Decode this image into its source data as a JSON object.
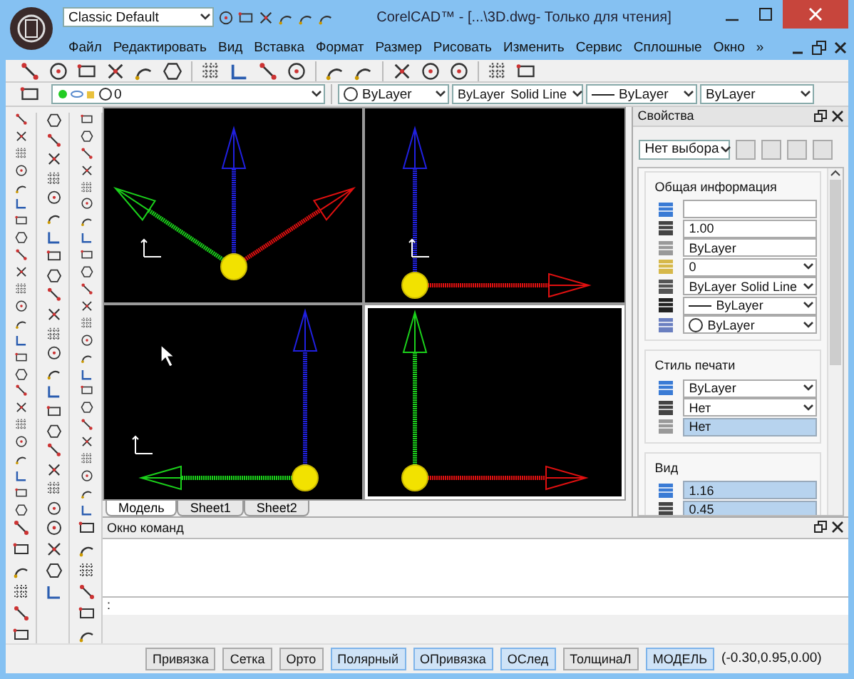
{
  "window": {
    "title": "CorelCAD™ - [...\\3D.dwg- Только для чтения]"
  },
  "workspace": {
    "value": "Classic Default"
  },
  "menu": {
    "items": [
      "Файл",
      "Редактировать",
      "Вид",
      "Вставка",
      "Формат",
      "Размер",
      "Рисовать",
      "Изменить",
      "Сервис",
      "Сплошные",
      "Окно"
    ],
    "more": "»"
  },
  "layer_bar": {
    "layer": "0",
    "color_label": "ByLayer",
    "linetype": "ByLayer",
    "linetype_name": "Solid Line",
    "lineweight": "ByLayer",
    "plot_style": "ByLayer"
  },
  "viewports": [
    {
      "active": false
    },
    {
      "active": false
    },
    {
      "active": false
    },
    {
      "active": true
    }
  ],
  "sheet_tabs": [
    {
      "label": "Модель",
      "selected": true
    },
    {
      "label": "Sheet1",
      "selected": false
    },
    {
      "label": "Sheet2",
      "selected": false
    }
  ],
  "properties": {
    "title": "Свойства",
    "selection": "Нет выбора",
    "sections": [
      {
        "title": "Общая информация",
        "rows": [
          {
            "kind": "input"
          },
          {
            "kind": "input",
            "value": "1.00"
          },
          {
            "kind": "input",
            "value": "ByLayer"
          },
          {
            "kind": "select",
            "value": "0"
          },
          {
            "kind": "select",
            "value": "ByLayer",
            "extra": "Solid Line"
          },
          {
            "kind": "line-select",
            "value": "ByLayer"
          },
          {
            "kind": "circle-select",
            "value": "ByLayer"
          }
        ]
      },
      {
        "title": "Стиль печати",
        "rows": [
          {
            "kind": "select",
            "value": "ByLayer"
          },
          {
            "kind": "select",
            "value": "Нет"
          },
          {
            "kind": "readonly",
            "value": "Нет"
          }
        ]
      },
      {
        "title": "Вид",
        "rows": [
          {
            "kind": "readonly",
            "value": "1.16"
          },
          {
            "kind": "readonly",
            "value": "0.45"
          }
        ]
      }
    ]
  },
  "command_window": {
    "title": "Окно команд",
    "prompt": ":"
  },
  "status_bar": {
    "toggles": [
      {
        "label": "Привязка",
        "on": false
      },
      {
        "label": "Сетка",
        "on": false
      },
      {
        "label": "Орто",
        "on": false
      },
      {
        "label": "Полярный",
        "on": true
      },
      {
        "label": "ОПривязка",
        "on": true
      },
      {
        "label": "ОСлед",
        "on": true
      },
      {
        "label": "ТолщинаЛ",
        "on": false
      },
      {
        "label": "МОДЕЛЬ",
        "on": true
      }
    ],
    "coordinates": "(-0.30,0.95,0.00)"
  }
}
